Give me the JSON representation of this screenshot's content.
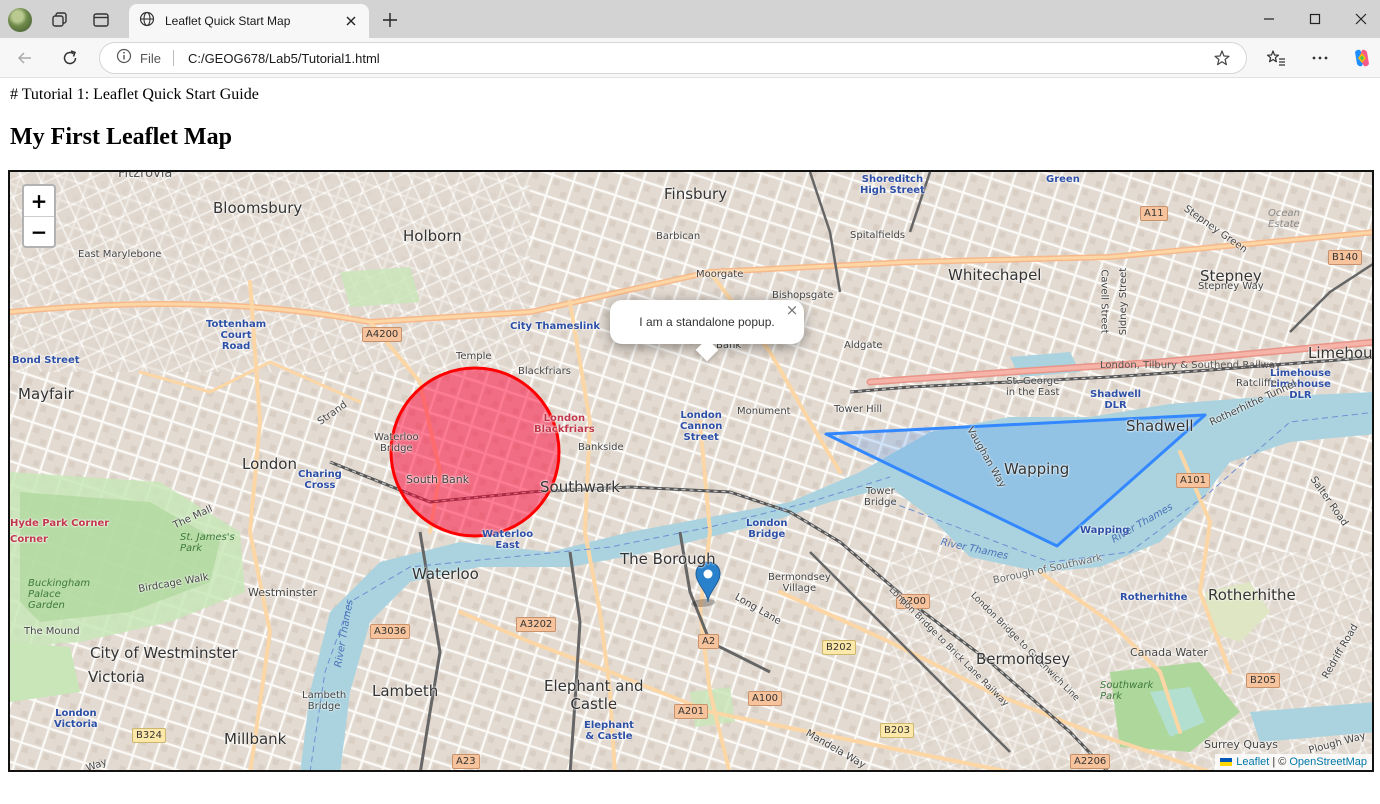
{
  "browser": {
    "tab_title": "Leaflet Quick Start Map",
    "url_prefix": "File",
    "url": "C:/GEOG678/Lab5/Tutorial1.html"
  },
  "page": {
    "markdown_line": "# Tutorial 1: Leaflet Quick Start Guide",
    "heading": "My First Leaflet Map"
  },
  "map": {
    "zoom_in_label": "+",
    "zoom_out_label": "−",
    "popup_text": "I am a standalone popup.",
    "popup_close": "×",
    "attribution": {
      "leaflet": "Leaflet",
      "separator": "| ©",
      "osm": "OpenStreetMap"
    },
    "circle": {
      "color": "#ff0000",
      "fill": "#f03",
      "fill_opacity": 0.5
    },
    "polygon": {
      "color": "#3388ff"
    },
    "marker": {
      "color": "#2a81cb"
    },
    "labels": {
      "fitzrovia": "Fitzrovia",
      "bloomsbury": "Bloomsbury",
      "holborn": "Holborn",
      "finsbury": "Finsbury",
      "shoreditch": "Shoreditch\nHigh Street",
      "green": "Green",
      "a11": "A11",
      "stepney_green": "Stepney Green",
      "ocean_estate": "Ocean\nEstate",
      "east_marylebone": "East Marylebone",
      "barbican": "Barbican",
      "spitalfields": "Spitalfields",
      "whitechapel": "Whitechapel",
      "stepney": "Stepney",
      "stepney_way": "Stepney Way",
      "b140": "B140",
      "moorgate": "Moorgate",
      "bishopsgate": "Bishopsgate",
      "cavell": "Cavell Street",
      "sidney": "Sidney Street",
      "tottenham": "Tottenham\nCourt\nRoad",
      "a4200": "A4200",
      "city_thameslink": "City Thameslink",
      "bond_street": "Bond Street",
      "temple": "Temple",
      "bank": "Bank",
      "aldgate": "Aldgate",
      "limehouse": "Limehouse",
      "blackfriars": "Blackfriars",
      "ltsr": "London, Tilbury & Southend Railway",
      "limehouse_dlr": "Limehouse\nLimehouse\nDLR",
      "mayfair": "Mayfair",
      "st_george": "St. George\nin the East",
      "shadwell_dlr": "Shadwell\nDLR",
      "ratcliffe": "Ratcliffe",
      "strand": "Strand",
      "london_blackfriars": "London\nBlackfriars",
      "monument": "Monument",
      "tower_hill": "Tower Hill",
      "london_cannon": "London\nCannon\nStreet",
      "shadwell": "Shadwell",
      "rotherhithe_tunnel": "Rotherhithe Tunnel",
      "waterloo_bridge": "Waterloo\nBridge",
      "bankside": "Bankside",
      "vaughan": "Vaughan Way",
      "wapping": "Wapping",
      "london": "London",
      "charing": "Charing\nCross",
      "south_bank": "South Bank",
      "southwark": "Southwark",
      "tower_bridge": "Tower\nBridge",
      "a101": "A101",
      "salter": "Salter Road",
      "the_mall": "The Mall",
      "waterloo_east": "Waterloo\nEast",
      "london_bridge": "London\nBridge",
      "wapping_stn": "Wapping",
      "hyde_park_corner": "Hyde Park Corner",
      "st_james": "St. James's\nPark",
      "the_borough": "The Borough",
      "river_thames": "River Thames",
      "borough_southwark": "Borough of Southwark",
      "corner": "Corner",
      "waterloo": "Waterloo",
      "bermondsey_village": "Bermondsey\nVillage",
      "buckingham": "Buckingham\nPalace\nGarden",
      "birdcage": "Birdcage Walk",
      "westminster": "Westminster",
      "long_lane": "Long Lane",
      "a200": "A200",
      "rotherhithe": "Rotherhithe",
      "rotherhithe2": "Rotherhithe",
      "the_mound": "The Mound",
      "a3036": "A3036",
      "a3202": "A3202",
      "a2": "A2",
      "b202": "B202",
      "lb_brick": "London Bridge to Brick Lane Railway",
      "lb_greenwich": "London Bridge to Greenwich Line",
      "canada_water": "Canada Water",
      "redriff": "Redriff Road",
      "city_westminster": "City of Westminster",
      "bermondsey": "Bermondsey",
      "b205": "B205",
      "victoria": "Victoria",
      "southwark_park": "Southwark\nPark",
      "lambeth": "Lambeth",
      "lambeth_bridge": "Lambeth\nBridge",
      "elephant": "Elephant and\nCastle",
      "a100": "A100",
      "london_victoria": "London\nVictoria",
      "a201": "A201",
      "elephant_stn": "Elephant\n& Castle",
      "b203": "B203",
      "b324": "B324",
      "millbank": "Millbank",
      "mandela": "Mandela Way",
      "surrey_quays": "Surrey Quays",
      "plough_way": "Plough Way",
      "a23": "A23",
      "a2206": "A2206",
      "river_thames2": "River Thames",
      "river_thames3": "River Thames",
      "ck_way": "Way"
    }
  }
}
